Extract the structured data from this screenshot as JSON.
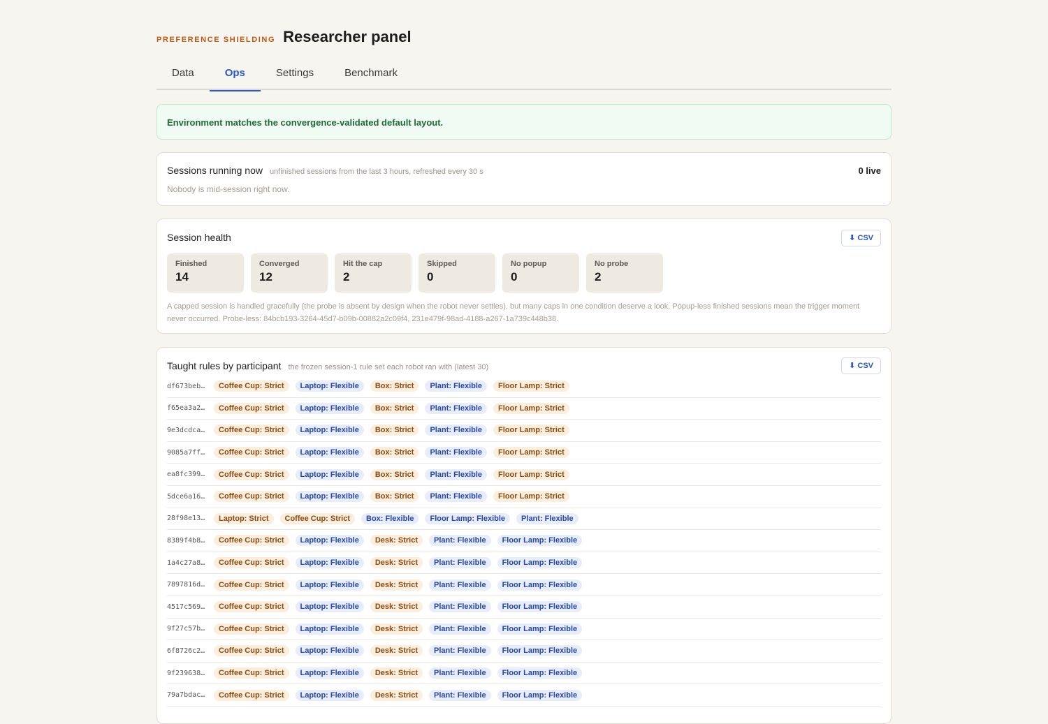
{
  "header": {
    "eyebrow": "PREFERENCE SHIELDING",
    "title": "Researcher panel"
  },
  "tabs": [
    {
      "label": "Data",
      "active": false
    },
    {
      "label": "Ops",
      "active": true
    },
    {
      "label": "Settings",
      "active": false
    },
    {
      "label": "Benchmark",
      "active": false
    }
  ],
  "banner": {
    "text": "Environment matches the convergence-validated default layout."
  },
  "sessions": {
    "title": "Sessions running now",
    "subtitle": "unfinished sessions from the last 3 hours, refreshed every 30 s",
    "live": "0 live",
    "empty": "Nobody is mid-session right now."
  },
  "health": {
    "title": "Session health",
    "csv_label": "⬇ CSV",
    "stats": [
      {
        "label": "Finished",
        "value": "14"
      },
      {
        "label": "Converged",
        "value": "12"
      },
      {
        "label": "Hit the cap",
        "value": "2"
      },
      {
        "label": "Skipped",
        "value": "0"
      },
      {
        "label": "No popup",
        "value": "0"
      },
      {
        "label": "No probe",
        "value": "2"
      }
    ],
    "note": "A capped session is handled gracefully (the probe is absent by design when the robot never settles), but many caps in one condition deserve a look. Popup-less finished sessions mean the trigger moment never occurred. Probe-less: 84bcb193-3264-45d7-b09b-00882a2c09f4, 231e479f-98ad-4188-a267-1a739c448b38."
  },
  "rules": {
    "title": "Taught rules by participant",
    "subtitle": "the frozen session-1 rule set each robot ran with (latest 30)",
    "csv_label": "⬇ CSV",
    "rows": [
      {
        "id": "df673beb…",
        "chips": [
          [
            "Coffee Cup: Strict",
            "strict"
          ],
          [
            "Laptop: Flexible",
            "flexible"
          ],
          [
            "Box: Strict",
            "strict"
          ],
          [
            "Plant: Flexible",
            "flexible"
          ],
          [
            "Floor Lamp: Strict",
            "strict"
          ]
        ]
      },
      {
        "id": "f65ea3a2…",
        "chips": [
          [
            "Coffee Cup: Strict",
            "strict"
          ],
          [
            "Laptop: Flexible",
            "flexible"
          ],
          [
            "Box: Strict",
            "strict"
          ],
          [
            "Plant: Flexible",
            "flexible"
          ],
          [
            "Floor Lamp: Strict",
            "strict"
          ]
        ]
      },
      {
        "id": "9e3dcdca…",
        "chips": [
          [
            "Coffee Cup: Strict",
            "strict"
          ],
          [
            "Laptop: Flexible",
            "flexible"
          ],
          [
            "Box: Strict",
            "strict"
          ],
          [
            "Plant: Flexible",
            "flexible"
          ],
          [
            "Floor Lamp: Strict",
            "strict"
          ]
        ]
      },
      {
        "id": "9085a7ff…",
        "chips": [
          [
            "Coffee Cup: Strict",
            "strict"
          ],
          [
            "Laptop: Flexible",
            "flexible"
          ],
          [
            "Box: Strict",
            "strict"
          ],
          [
            "Plant: Flexible",
            "flexible"
          ],
          [
            "Floor Lamp: Strict",
            "strict"
          ]
        ]
      },
      {
        "id": "ea8fc399…",
        "chips": [
          [
            "Coffee Cup: Strict",
            "strict"
          ],
          [
            "Laptop: Flexible",
            "flexible"
          ],
          [
            "Box: Strict",
            "strict"
          ],
          [
            "Plant: Flexible",
            "flexible"
          ],
          [
            "Floor Lamp: Strict",
            "strict"
          ]
        ]
      },
      {
        "id": "5dce6a16…",
        "chips": [
          [
            "Coffee Cup: Strict",
            "strict"
          ],
          [
            "Laptop: Flexible",
            "flexible"
          ],
          [
            "Box: Strict",
            "strict"
          ],
          [
            "Plant: Flexible",
            "flexible"
          ],
          [
            "Floor Lamp: Strict",
            "strict"
          ]
        ]
      },
      {
        "id": "28f98e13…",
        "chips": [
          [
            "Laptop: Strict",
            "strict"
          ],
          [
            "Coffee Cup: Strict",
            "strict"
          ],
          [
            "Box: Flexible",
            "flexible"
          ],
          [
            "Floor Lamp: Flexible",
            "flexible"
          ],
          [
            "Plant: Flexible",
            "flexible"
          ]
        ]
      },
      {
        "id": "8389f4b8…",
        "chips": [
          [
            "Coffee Cup: Strict",
            "strict"
          ],
          [
            "Laptop: Flexible",
            "flexible"
          ],
          [
            "Desk: Strict",
            "strict"
          ],
          [
            "Plant: Flexible",
            "flexible"
          ],
          [
            "Floor Lamp: Flexible",
            "flexible"
          ]
        ]
      },
      {
        "id": "1a4c27a8…",
        "chips": [
          [
            "Coffee Cup: Strict",
            "strict"
          ],
          [
            "Laptop: Flexible",
            "flexible"
          ],
          [
            "Desk: Strict",
            "strict"
          ],
          [
            "Plant: Flexible",
            "flexible"
          ],
          [
            "Floor Lamp: Flexible",
            "flexible"
          ]
        ]
      },
      {
        "id": "7897816d…",
        "chips": [
          [
            "Coffee Cup: Strict",
            "strict"
          ],
          [
            "Laptop: Flexible",
            "flexible"
          ],
          [
            "Desk: Strict",
            "strict"
          ],
          [
            "Plant: Flexible",
            "flexible"
          ],
          [
            "Floor Lamp: Flexible",
            "flexible"
          ]
        ]
      },
      {
        "id": "4517c569…",
        "chips": [
          [
            "Coffee Cup: Strict",
            "strict"
          ],
          [
            "Laptop: Flexible",
            "flexible"
          ],
          [
            "Desk: Strict",
            "strict"
          ],
          [
            "Plant: Flexible",
            "flexible"
          ],
          [
            "Floor Lamp: Flexible",
            "flexible"
          ]
        ]
      },
      {
        "id": "9f27c57b…",
        "chips": [
          [
            "Coffee Cup: Strict",
            "strict"
          ],
          [
            "Laptop: Flexible",
            "flexible"
          ],
          [
            "Desk: Strict",
            "strict"
          ],
          [
            "Plant: Flexible",
            "flexible"
          ],
          [
            "Floor Lamp: Flexible",
            "flexible"
          ]
        ]
      },
      {
        "id": "6f8726c2…",
        "chips": [
          [
            "Coffee Cup: Strict",
            "strict"
          ],
          [
            "Laptop: Flexible",
            "flexible"
          ],
          [
            "Desk: Strict",
            "strict"
          ],
          [
            "Plant: Flexible",
            "flexible"
          ],
          [
            "Floor Lamp: Flexible",
            "flexible"
          ]
        ]
      },
      {
        "id": "9f239638…",
        "chips": [
          [
            "Coffee Cup: Strict",
            "strict"
          ],
          [
            "Laptop: Flexible",
            "flexible"
          ],
          [
            "Desk: Strict",
            "strict"
          ],
          [
            "Plant: Flexible",
            "flexible"
          ],
          [
            "Floor Lamp: Flexible",
            "flexible"
          ]
        ]
      },
      {
        "id": "79a7bdac…",
        "chips": [
          [
            "Coffee Cup: Strict",
            "strict"
          ],
          [
            "Laptop: Flexible",
            "flexible"
          ],
          [
            "Desk: Strict",
            "strict"
          ],
          [
            "Plant: Flexible",
            "flexible"
          ],
          [
            "Floor Lamp: Flexible",
            "flexible"
          ]
        ]
      }
    ]
  }
}
